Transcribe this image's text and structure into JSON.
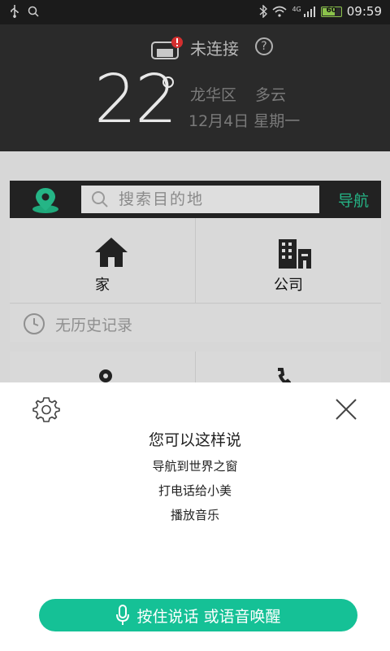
{
  "status_bar": {
    "time": "09:59",
    "battery_level": "60",
    "network": "4G"
  },
  "header": {
    "connection_status": "未连接",
    "help_label": "?",
    "temperature": "22",
    "district": "龙华区",
    "weather": "多云",
    "date": "12月4日 星期一"
  },
  "search": {
    "placeholder": "搜索目的地",
    "nav_label": "导航"
  },
  "places": {
    "home_label": "家",
    "company_label": "公司"
  },
  "history": {
    "empty_label": "无历史记录"
  },
  "voice": {
    "title": "您可以这样说",
    "examples": [
      "导航到世界之窗",
      "打电话给小美",
      "播放音乐"
    ],
    "talk_button": "按住说话 或语音唤醒"
  },
  "colors": {
    "accent": "#15c196",
    "nav_green": "#25b586",
    "header_bg": "#2a2a2a",
    "alert_red": "#d32f2f"
  }
}
